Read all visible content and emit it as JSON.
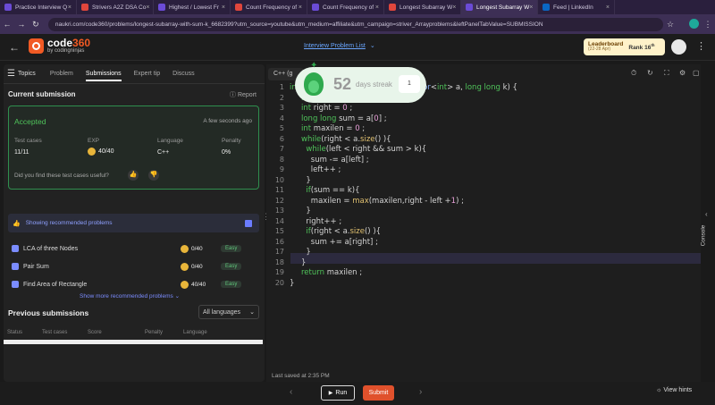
{
  "browser": {
    "tabs": [
      {
        "label": "Practice Interview Q",
        "color": "#6b4bd6"
      },
      {
        "label": "Strivers A2Z DSA Co",
        "color": "#e0463c"
      },
      {
        "label": "Highest / Lowest Fr",
        "color": "#6b4bd6"
      },
      {
        "label": "Count Frequency of",
        "color": "#e0463c"
      },
      {
        "label": "Count Frequency of",
        "color": "#6b4bd6"
      },
      {
        "label": "Longest Subarray W",
        "color": "#e0463c"
      },
      {
        "label": "Longest Subarray W",
        "color": "#6b4bd6"
      },
      {
        "label": "Feed | LinkedIn",
        "color": "#0a66c2"
      }
    ],
    "url": "naukri.com/code360/problems/longest-subarray-with-sum-k_6682399?utm_source=youtube&utm_medium=affiliate&utm_campaign=striver_Arrayproblems&leftPanelTabValue=SUBMISSION"
  },
  "header": {
    "logo_main": "code",
    "logo_num": "360",
    "logo_sub": "by codingninjas",
    "problem_list": "Interview Problem List",
    "leaderboard": "Leaderboard",
    "leaderboard_dates": "(22-28 Apr)",
    "rank": "Rank 16",
    "rank_sup": "th"
  },
  "streak": {
    "count": "52",
    "label": "days streak",
    "badge": "1"
  },
  "left_tabs": {
    "topics": "Topics",
    "problem": "Problem",
    "submissions": "Submissions",
    "export_tip": "Expert tip",
    "discuss": "Discuss"
  },
  "current": {
    "title": "Current submission",
    "report": "Report",
    "status": "Accepted",
    "time": "A few seconds ago",
    "labels": {
      "tests": "Test cases",
      "exp": "EXP",
      "lang": "Language",
      "penalty": "Penalty"
    },
    "values": {
      "tests": "11/11",
      "exp": "40/40",
      "lang": "C++",
      "penalty": "0%"
    },
    "useful": "Did you find these test cases useful?"
  },
  "recommended": {
    "banner": "Showing recommended problems",
    "items": [
      {
        "name": "LCA of three Nodes",
        "score": "0/40",
        "difficulty": "Easy"
      },
      {
        "name": "Pair Sum",
        "score": "0/40",
        "difficulty": "Easy"
      },
      {
        "name": "Find Area of Rectangle",
        "score": "40/40",
        "difficulty": "Easy"
      }
    ],
    "more": "Show more recommended problems"
  },
  "previous": {
    "title": "Previous submissions",
    "filter": "All languages",
    "columns": [
      "Status",
      "Test cases",
      "Score",
      "Penalty",
      "Language"
    ]
  },
  "editor": {
    "language": "C++ (g",
    "last_saved": "Last saved at 2:35 PM",
    "side_label": "Console"
  },
  "footer": {
    "run": "Run",
    "submit": "Submit",
    "hints": "View hints"
  }
}
